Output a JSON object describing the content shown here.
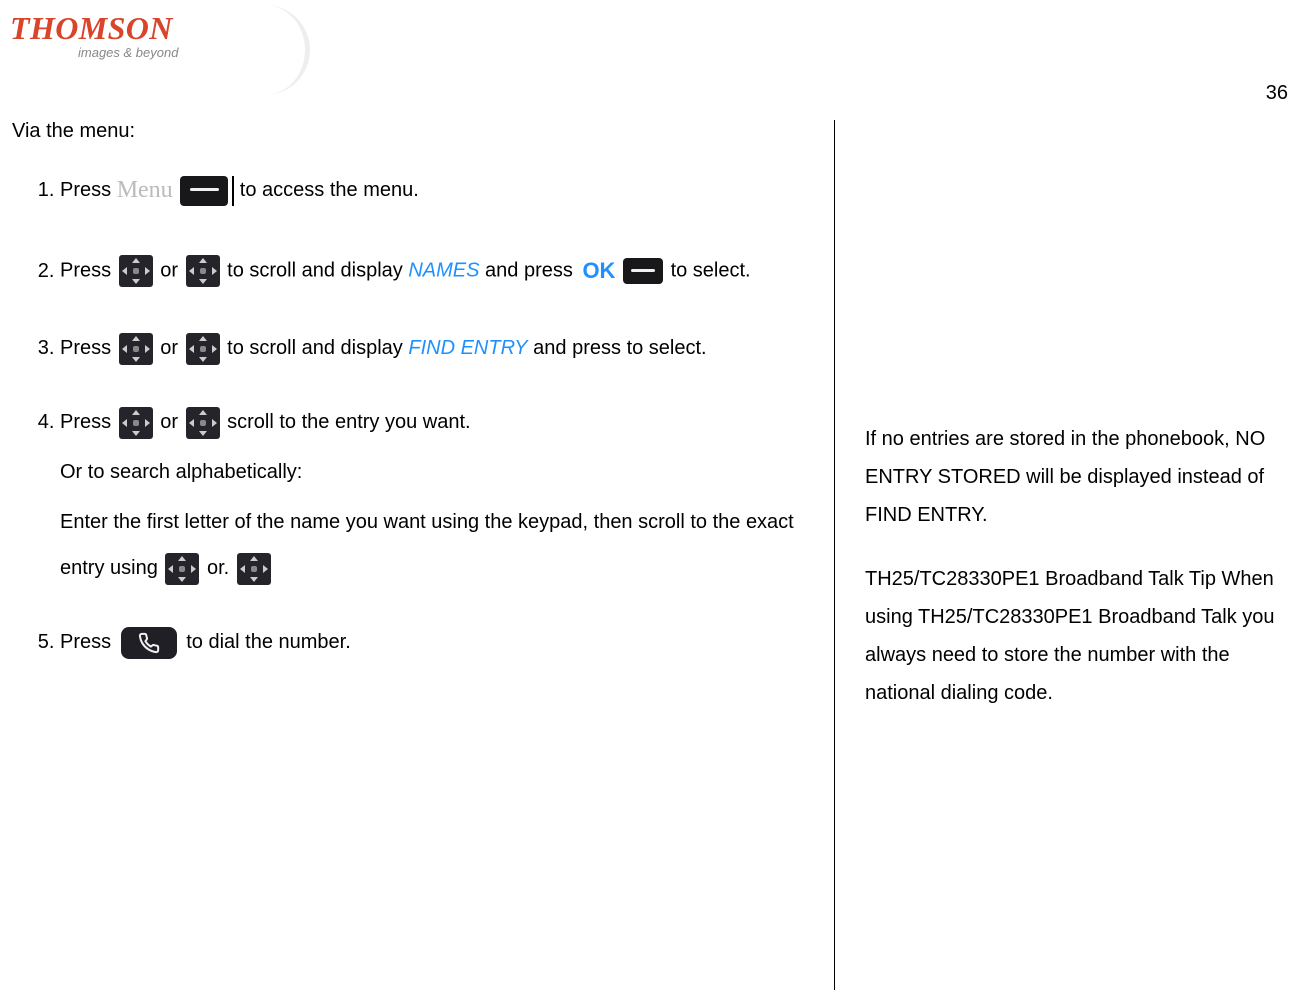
{
  "brand": "THOMSON",
  "tagline": "images & beyond",
  "page_number": "36",
  "intro": "Via the menu:",
  "steps": {
    "s1": {
      "press": "Press ",
      "menu_word": "Menu",
      "tail": " to access the menu."
    },
    "s2": {
      "press": "Press ",
      "or": " or ",
      "scroll": " to scroll and display ",
      "names": "NAMES",
      "and_press": " and press ",
      "ok": "OK",
      "tail": " to select."
    },
    "s3": {
      "press": "Press ",
      "or": " or ",
      "scroll": " to scroll and display ",
      "find": "FIND ENTRY",
      "tail": " and press to select."
    },
    "s4": {
      "press": "Press ",
      "or": " or ",
      "scroll": " scroll to the entry you want.",
      "alt1": "Or to search alphabetically:",
      "alt2a": "Enter the first letter of the name you want using the keypad, then scroll to the exact entry using ",
      "or2": " or. "
    },
    "s5": {
      "press": "Press ",
      "tail": " to dial the number."
    }
  },
  "notes": {
    "p1": "If no entries are stored in the phonebook, NO ENTRY STORED will be displayed instead of FIND ENTRY.",
    "p2": "TH25/TC28330PE1 Broadband Talk Tip When using TH25/TC28330PE1 Broadband Talk you always need to store the number with the national dialing code."
  }
}
